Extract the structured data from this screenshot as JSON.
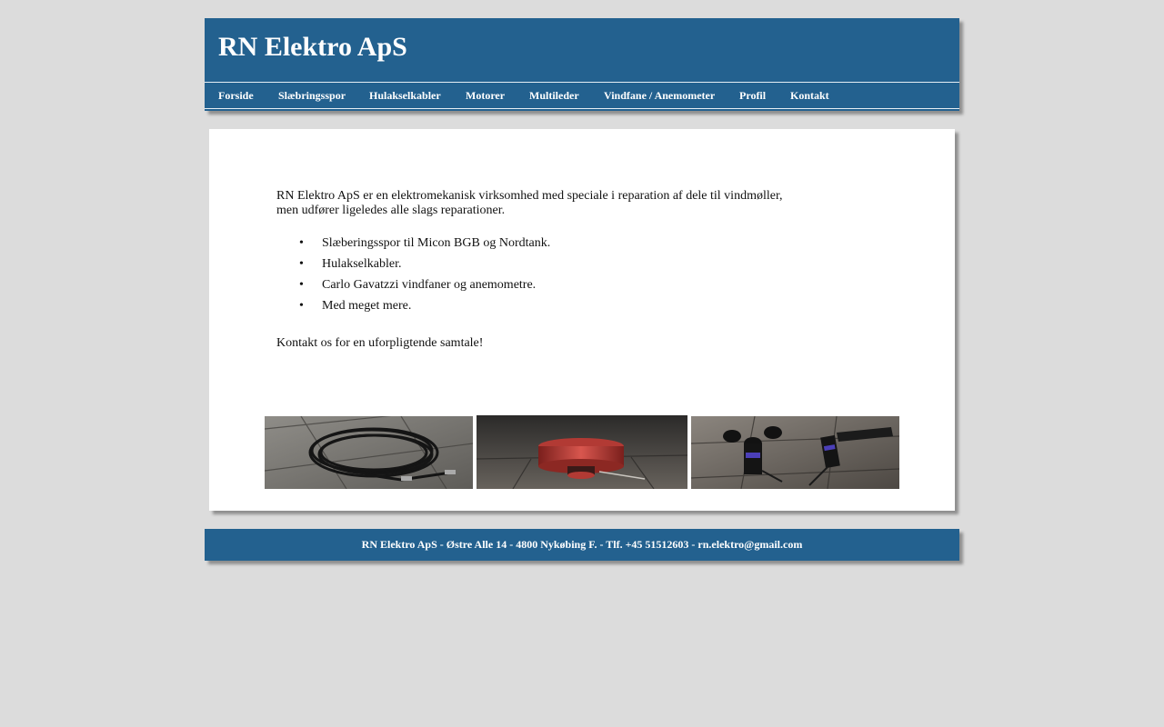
{
  "header": {
    "title": "RN Elektro ApS",
    "nav": [
      {
        "label": "Forside"
      },
      {
        "label": "Slæbringsspor"
      },
      {
        "label": "Hulakselkabler"
      },
      {
        "label": "Motorer"
      },
      {
        "label": "Multileder"
      },
      {
        "label": "Vindfane / Anemometer"
      },
      {
        "label": "Profil"
      },
      {
        "label": "Kontakt"
      }
    ]
  },
  "main": {
    "intro_line1": "RN Elektro ApS er en elektromekanisk virksomhed med speciale i reparation af dele til vindmøller,",
    "intro_line2": "men udfører ligeledes alle slags reparationer.",
    "bullet_symbol": "•",
    "bullets": [
      "Slæberingsspor til Micon BGB og Nordtank.",
      "Hulakselkabler.",
      "Carlo Gavatzzi vindfaner og anemometre.",
      "Med meget mere."
    ],
    "outro": "Kontakt os for en uforpligtende samtale!",
    "photos": [
      {
        "subject": "coiled-cable-photo"
      },
      {
        "subject": "slip-ring-photo"
      },
      {
        "subject": "wind-vane-anemometer-photo"
      }
    ]
  },
  "footer": {
    "text": "RN Elektro ApS - Østre Alle 14 - 4800 Nykøbing F. - Tlf. +45 51512603 - rn.elektro@gmail.com"
  },
  "colors": {
    "page_bg": "#dcdcdc",
    "brand_blue": "#23618f",
    "content_bg": "#ffffff",
    "text": "#111111"
  }
}
